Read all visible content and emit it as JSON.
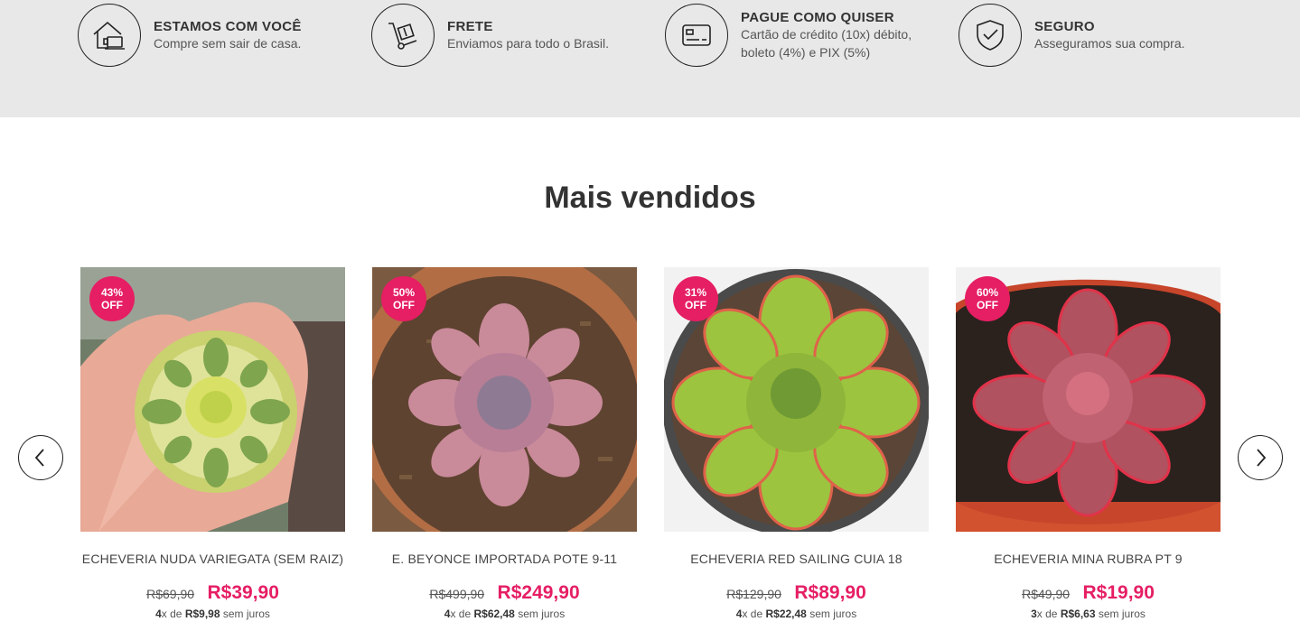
{
  "benefits": [
    {
      "title": "ESTAMOS COM VOCÊ",
      "desc": "Compre sem sair de casa.",
      "icon": "house-laptop-icon"
    },
    {
      "title": "FRETE",
      "desc": "Enviamos para todo o Brasil.",
      "icon": "hand-truck-icon"
    },
    {
      "title": "PAGUE COMO QUISER",
      "desc": "Cartão de crédito (10x) débito, boleto (4%) e PIX (5%)",
      "icon": "credit-card-icon"
    },
    {
      "title": "SEGURO",
      "desc": "Asseguramos sua compra.",
      "icon": "shield-check-icon"
    }
  ],
  "section_title": "Mais vendidos",
  "colors": {
    "accent": "#e61e63",
    "bar_bg": "#e8e8e8"
  },
  "products": [
    {
      "badge_pct": "43%",
      "badge_off": "OFF",
      "name": "ECHEVERIA NUDA VARIEGATA (SEM RAIZ)",
      "old_price": "R$69,90",
      "price": "R$39,90",
      "inst_count": "4",
      "inst_mid": "x de ",
      "inst_value": "R$9,98",
      "inst_suffix": " sem juros"
    },
    {
      "badge_pct": "50%",
      "badge_off": "OFF",
      "name": "E. BEYONCE IMPORTADA POTE 9-11",
      "old_price": "R$499,90",
      "price": "R$249,90",
      "inst_count": "4",
      "inst_mid": "x de ",
      "inst_value": "R$62,48",
      "inst_suffix": " sem juros"
    },
    {
      "badge_pct": "31%",
      "badge_off": "OFF",
      "name": "ECHEVERIA RED SAILING CUIA 18",
      "old_price": "R$129,90",
      "price": "R$89,90",
      "inst_count": "4",
      "inst_mid": "x de ",
      "inst_value": "R$22,48",
      "inst_suffix": " sem juros"
    },
    {
      "badge_pct": "60%",
      "badge_off": "OFF",
      "name": "ECHEVERIA MINA RUBRA PT 9",
      "old_price": "R$49,90",
      "price": "R$19,90",
      "inst_count": "3",
      "inst_mid": "x de ",
      "inst_value": "R$6,63",
      "inst_suffix": " sem juros"
    }
  ]
}
